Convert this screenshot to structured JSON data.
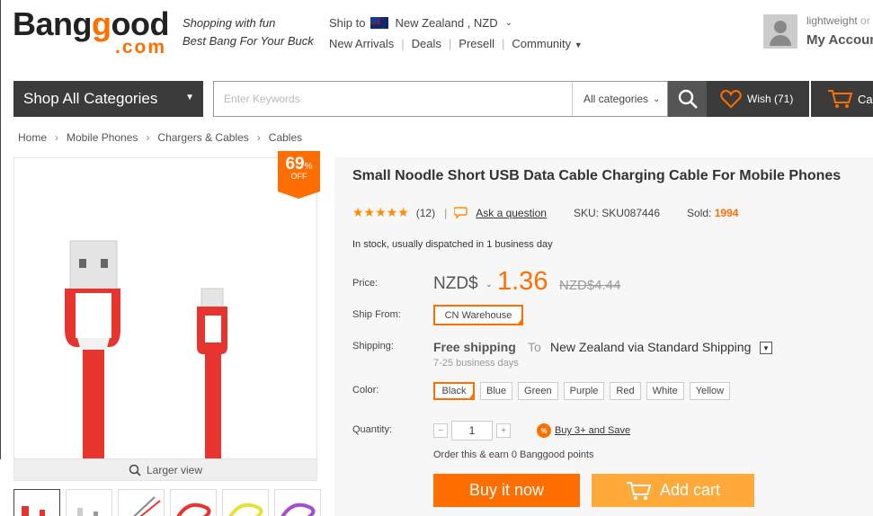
{
  "header": {
    "logo_text_main": "Banggood",
    "logo_text_com": ".com",
    "tagline_1": "Shopping with fun",
    "tagline_2": "Best Bang For Your Buck",
    "ship_to_label": "Ship to",
    "ship_to_value": "New Zealand , NZD",
    "nav": [
      "New Arrivals",
      "Deals",
      "Presell",
      "Community"
    ],
    "account_user": "lightweight",
    "account_or": "or",
    "account_label": "My Account"
  },
  "searchbar": {
    "shop_all": "Shop All Categories",
    "placeholder": "Enter Keywords",
    "category": "All categories",
    "wish_label": "Wish (71)",
    "cart_label": "Ca"
  },
  "breadcrumb": [
    "Home",
    "Mobile Phones",
    "Chargers & Cables",
    "Cables"
  ],
  "gallery": {
    "discount": "69",
    "discount_unit": "%",
    "discount_off": "OFF",
    "larger_view": "Larger view",
    "thumbnails": [
      "thumb-1",
      "thumb-2",
      "thumb-3",
      "thumb-4",
      "thumb-5",
      "thumb-6"
    ]
  },
  "product": {
    "title": "Small Noodle Short USB Data Cable Charging Cable For Mobile Phones",
    "stars": "★★★★★",
    "review_count": "(12)",
    "ask_question": "Ask a question",
    "sku": "SKU: SKU087446",
    "sold_label": "Sold:",
    "sold_value": "1994",
    "stock": "In stock, usually dispatched in 1 business day",
    "price_label": "Price:",
    "currency": "NZD$",
    "price": "1.36",
    "old_price": "NZD$4.44",
    "ship_from_label": "Ship From:",
    "warehouse": "CN Warehouse",
    "shipping_label": "Shipping:",
    "free_shipping": "Free shipping",
    "ship_to": "To",
    "ship_dest": "New Zealand via Standard Shipping",
    "ship_days": "7-25 business days",
    "color_label": "Color:",
    "colors": [
      "Black",
      "Blue",
      "Green",
      "Purple",
      "Red",
      "White",
      "Yellow"
    ],
    "selected_color": "Black",
    "quantity_label": "Quantity:",
    "quantity": "1",
    "buy_save": "Buy 3+ and Save",
    "points": "Order this & earn 0 Banggood points",
    "buy_now": "Buy it now",
    "add_cart": "Add cart"
  },
  "colors": {
    "accent": "#ff6e00",
    "dark_bar": "#3b3b3b",
    "cart_button": "#ffa93a"
  }
}
